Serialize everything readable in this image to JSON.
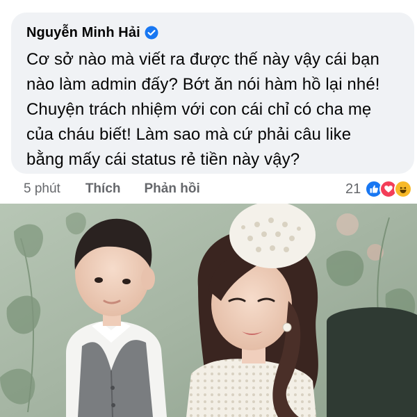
{
  "comment": {
    "author": "Nguyễn Minh Hải",
    "verified": true,
    "text": "Cơ sở nào mà viết ra được thế này vậy cái bạn\nnào làm admin đấy? Bớt ăn nói hàm hồ lại nhé!\nChuyện trách nhiệm với con cái chỉ có cha mẹ\ncủa cháu biết! Làm sao mà cứ phải câu like\nbằng mấy cái status rẻ tiền này vậy?"
  },
  "actions": {
    "time": "5 phút",
    "like": "Thích",
    "reply": "Phản hồi"
  },
  "reactions": {
    "count": "21",
    "types": [
      "like-icon",
      "love-icon",
      "haha-icon"
    ]
  },
  "colors": {
    "bubble": "#f0f2f5",
    "verified": "#1877f2",
    "wallpaper": "#a9b8a8"
  }
}
